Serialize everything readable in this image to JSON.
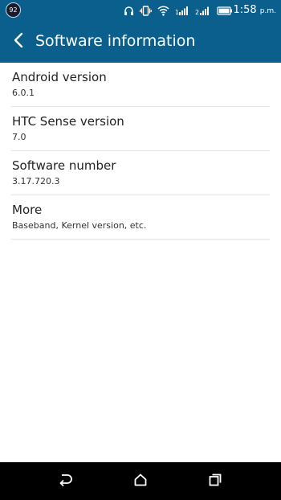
{
  "status_bar": {
    "notification_count": "92",
    "icons": [
      "headphones-icon",
      "vibrate-icon",
      "wifi-icon",
      "signal-icon",
      "signal-2-icon",
      "battery-icon"
    ],
    "time": "1:58",
    "ampm": "p.m."
  },
  "app_bar": {
    "title": "Software information",
    "back_icon": "chevron-left-icon"
  },
  "items": [
    {
      "title": "Android version",
      "value": "6.0.1"
    },
    {
      "title": "HTC Sense version",
      "value": "7.0"
    },
    {
      "title": "Software number",
      "value": "3.17.720.3"
    },
    {
      "title": "More",
      "value": "Baseband, Kernel version, etc."
    }
  ],
  "nav_bar": {
    "icons": [
      "back-arrow-icon",
      "home-icon",
      "recents-icon"
    ]
  },
  "colors": {
    "app_bar": "#0b5f8c",
    "background": "#ffffff",
    "nav_bar": "#000000",
    "divider": "#e4e4e4"
  }
}
